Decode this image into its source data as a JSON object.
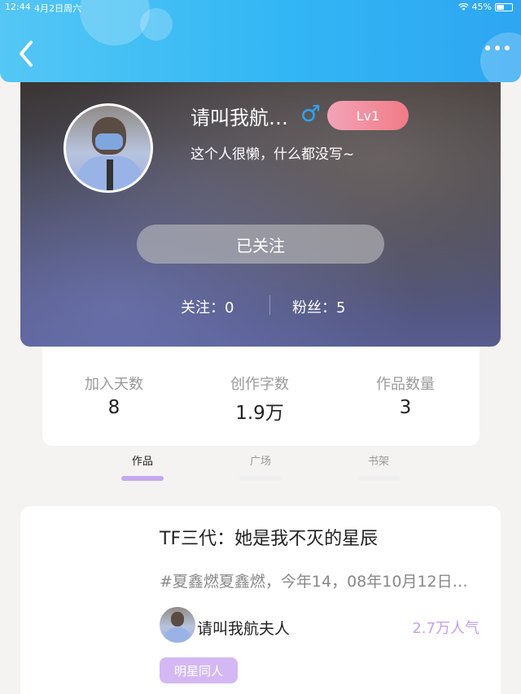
{
  "status_bar": {
    "time": "12:44",
    "date": "4月2日周六",
    "battery": "45%"
  },
  "profile": {
    "name": "请叫我航…",
    "gender_symbol": "♂",
    "level": "Lv1",
    "bio": "这个人很懒，什么都没写~",
    "follow_button": "已关注",
    "following_label": "关注：0",
    "fans_label": "粉丝：5"
  },
  "stats": [
    {
      "label": "加入天数",
      "value": "8"
    },
    {
      "label": "创作字数",
      "value": "1.9万"
    },
    {
      "label": "作品数量",
      "value": "3"
    }
  ],
  "tabs": [
    {
      "label": "作品",
      "active": true
    },
    {
      "label": "广场",
      "active": false
    },
    {
      "label": "书架",
      "active": false
    }
  ],
  "work": {
    "title": "TF三代：她是我不灭的星辰",
    "tags": "#夏鑫燃夏鑫燃，今年14，08年10月12日…",
    "author": "请叫我航夫人",
    "popularity": "2.7万人气",
    "category": "明星同人"
  },
  "colors": {
    "header": "#32b6f4",
    "accent": "#c59ff0",
    "level_badge": "#f07b86"
  },
  "icons": [
    "back-icon",
    "more-icon",
    "wifi-icon",
    "battery-icon",
    "male-icon"
  ]
}
